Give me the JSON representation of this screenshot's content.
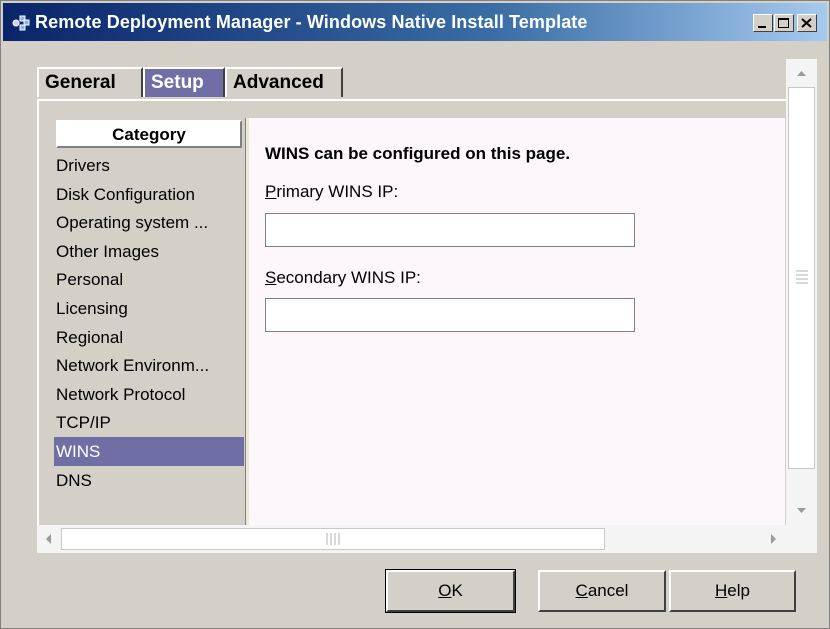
{
  "window": {
    "title": "Remote Deployment Manager - Windows Native Install Template",
    "controls": {
      "minimize": "minimize-icon",
      "maximize": "maximize-icon",
      "close": "close-icon"
    }
  },
  "tabs": [
    {
      "label": "General",
      "active": false
    },
    {
      "label": "Setup",
      "active": true
    },
    {
      "label": "Advanced",
      "active": false
    }
  ],
  "category": {
    "header": "Category",
    "items": [
      "Drivers",
      "Disk Configuration",
      "Operating system ...",
      "Other Images",
      "Personal",
      "Licensing",
      "Regional",
      "Network Environm...",
      "Network Protocol",
      "TCP/IP",
      "WINS",
      "DNS"
    ],
    "selected": "WINS"
  },
  "content": {
    "title": "WINS can be configured on this page.",
    "primary_label_mnemonic": "P",
    "primary_label_rest": "rimary WINS IP:",
    "primary_value": "",
    "secondary_label_mnemonic": "S",
    "secondary_label_rest": "econdary WINS IP:",
    "secondary_value": ""
  },
  "buttons": {
    "ok_mnemonic": "O",
    "ok_rest": "K",
    "cancel_mnemonic": "C",
    "cancel_rest": "ancel",
    "help_mnemonic": "H",
    "help_rest": "elp"
  },
  "colors": {
    "selection": "#6f6fa6",
    "titlebar_start": "#0a246a",
    "face": "#d4d0c8"
  }
}
